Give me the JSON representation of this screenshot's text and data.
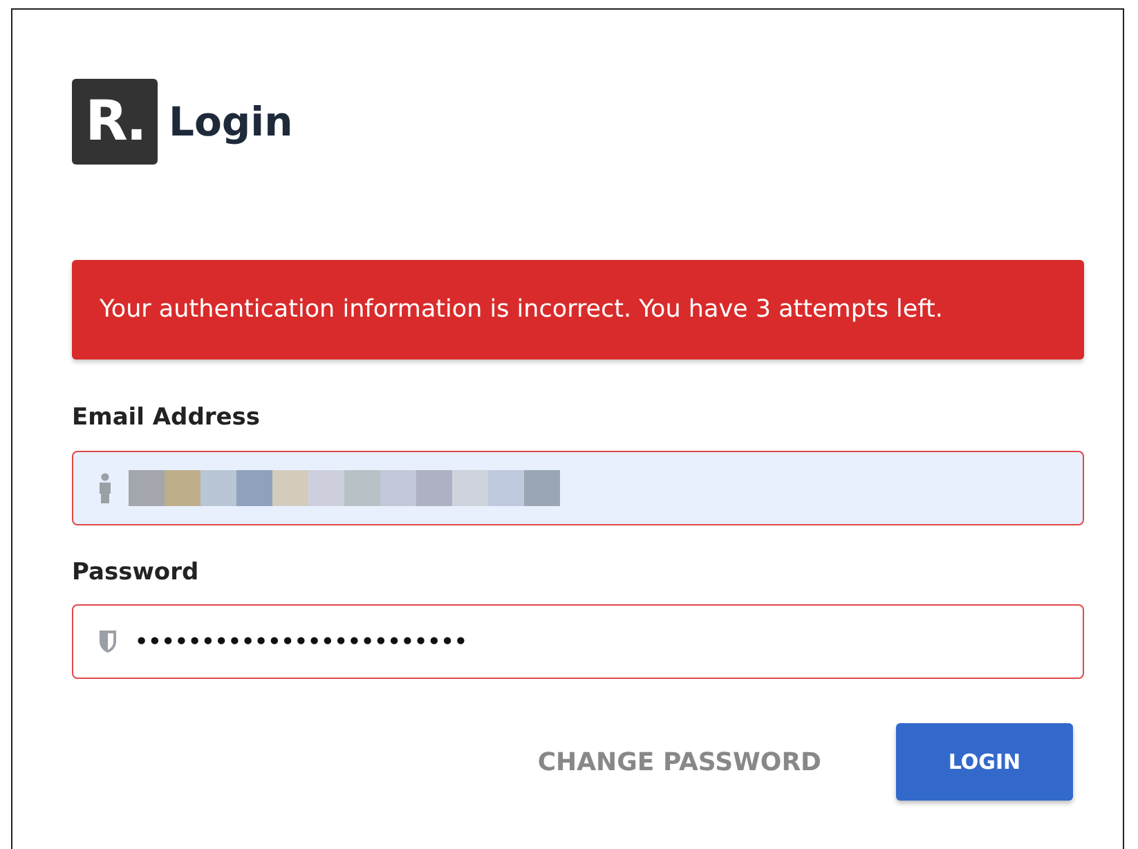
{
  "header": {
    "logo": "R.",
    "title": "Login"
  },
  "alert": {
    "text": "Your authentication information is incorrect. You have 3 attempts left."
  },
  "fields": [
    {
      "label": "Email Address",
      "kind": "email",
      "invalid": true,
      "autofilled": true,
      "redacted": true
    },
    {
      "label": "Password",
      "kind": "password",
      "invalid": true,
      "autofilled": false,
      "value": "•••••••••••••••••••••••••"
    }
  ],
  "actions": [
    {
      "label": "CHANGE PASSWORD",
      "kind": "link"
    },
    {
      "label": "LOGIN",
      "kind": "primary"
    }
  ]
}
